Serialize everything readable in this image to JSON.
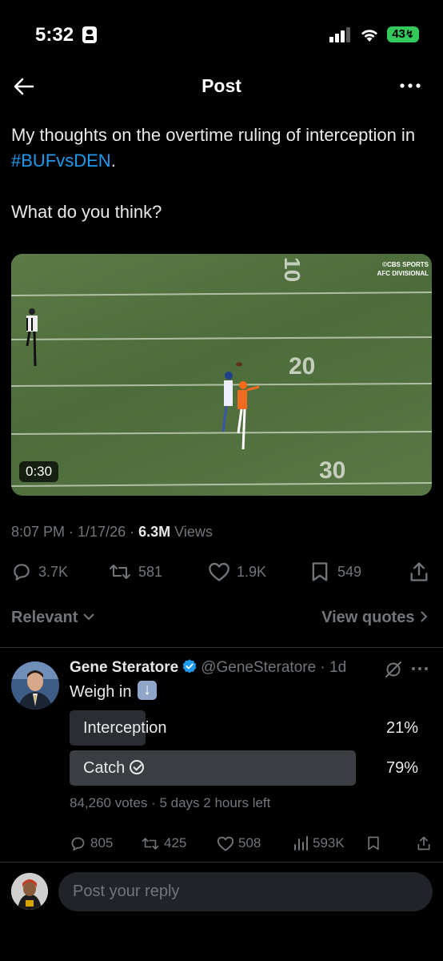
{
  "status_bar": {
    "time": "5:32",
    "battery": "43"
  },
  "header": {
    "title": "Post"
  },
  "tweet": {
    "text_before": "My thoughts on the overtime ruling of interception in ",
    "hashtag": "#BUFvsDEN",
    "text_after": ".",
    "question": "What do you think?",
    "video": {
      "duration": "0:30",
      "broadcaster": "©CBS SPORTS",
      "broadcast_sub": "AFC DIVISIONAL"
    },
    "time": "8:07 PM",
    "date": "1/17/26",
    "views_count": "6.3M",
    "views_label": "Views",
    "replies": "3.7K",
    "reposts": "581",
    "likes": "1.9K",
    "bookmarks": "549"
  },
  "sort": {
    "label": "Relevant",
    "view_quotes": "View quotes"
  },
  "reply": {
    "name": "Gene Steratore",
    "handle": "@GeneSteratore",
    "age": "1d",
    "text": "Weigh in",
    "poll": {
      "options": [
        {
          "label": "Interception",
          "percent": "21%",
          "fraction": 0.21,
          "winner": false
        },
        {
          "label": "Catch",
          "percent": "79%",
          "fraction": 0.79,
          "winner": true
        }
      ],
      "votes": "84,260 votes",
      "time_left": "5 days 2 hours left"
    },
    "replies": "805",
    "reposts": "425",
    "likes": "508",
    "views": "593K"
  },
  "composer": {
    "placeholder": "Post your reply"
  },
  "colors": {
    "accent": "#1d9bf0",
    "muted": "#71767b",
    "poll_win": "#3a3d41",
    "poll_lose": "#2a2d31"
  }
}
